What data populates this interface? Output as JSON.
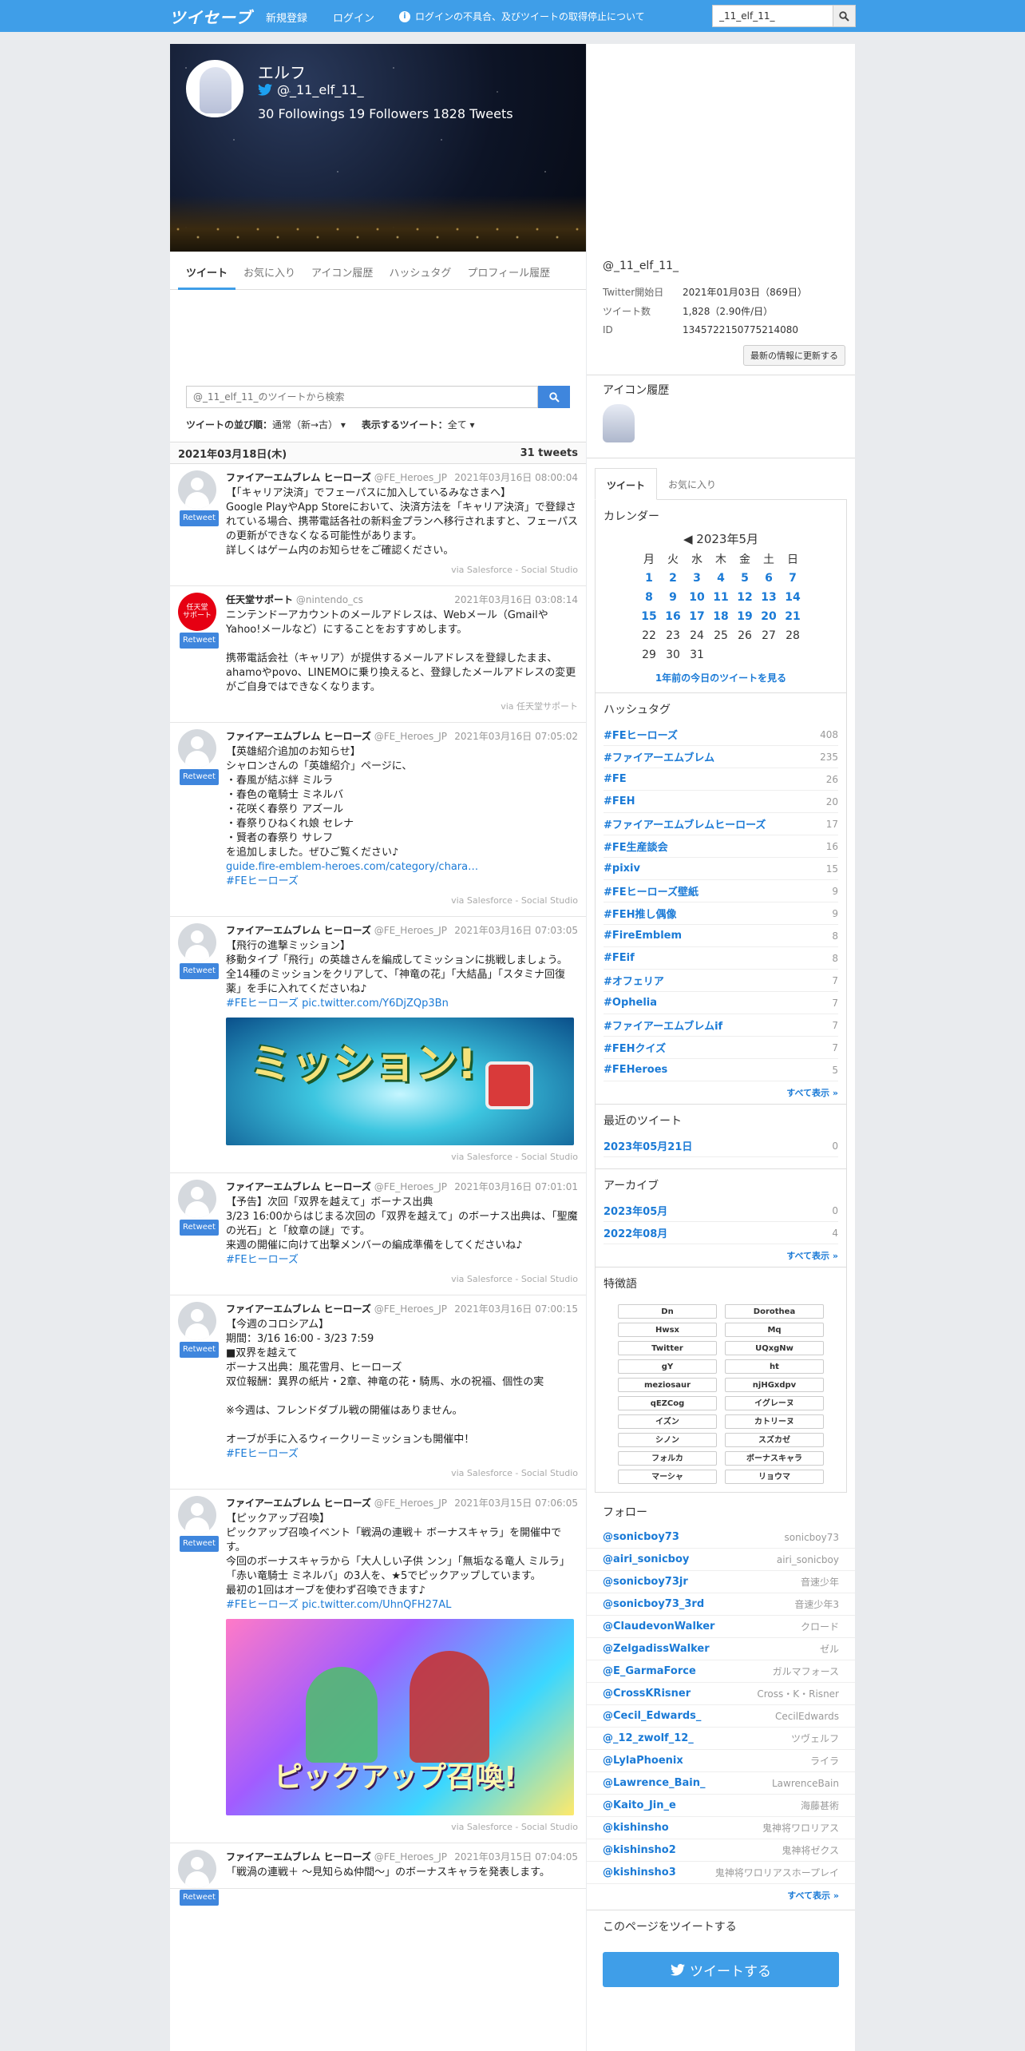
{
  "nav": {
    "logo": "ツイセーブ",
    "signup": "新規登録",
    "login": "ログイン",
    "notice": "ログインの不具合、及びツイートの取得停止について",
    "search_value": "_11_elf_11_"
  },
  "profile": {
    "name": "エルフ",
    "handle": "@_11_elf_11_",
    "stats": "30 Followings  19 Followers  1828 Tweets"
  },
  "tabs": [
    "ツイート",
    "お気に入り",
    "アイコン履歴",
    "ハッシュタグ",
    "プロフィール履歴"
  ],
  "search": {
    "placeholder": "@_11_elf_11_のツイートから検索"
  },
  "sort": {
    "order_label": "ツイートの並び順：",
    "order_value": "通常（新→古）",
    "show_label": "表示するツイート：",
    "show_value": "全て"
  },
  "date_header": {
    "date": "2021年03月18日(木)",
    "count": "31 tweets"
  },
  "retweet_label": "Retweet",
  "tweets": [
    {
      "name": "ファイアーエムブレム ヒーローズ",
      "handle": "@FE_Heroes_JP",
      "time": "2021年03月16日 08:00:04",
      "text": "【「キャリア決済」でフェーパスに加入しているみなさまへ】\nGoogle PlayやApp Storeにおいて、決済方法を「キャリア決済」で登録されている場合、携帯電話各社の新料金プランへ移行されますと、フェーパスの更新ができなくなる可能性があります。\n詳しくはゲーム内のお知らせをご確認ください。",
      "via": "via Salesforce - Social Studio"
    },
    {
      "name": "任天堂サポート",
      "handle": "@nintendo_cs",
      "time": "2021年03月16日 03:08:14",
      "text": "ニンテンドーアカウントのメールアドレスは、Webメール（GmailやYahoo!メールなど）にすることをおすすめします。\n\n携帯電話会社（キャリア）が提供するメールアドレスを登録したまま、ahamoやpovo、LINEMOに乗り換えると、登録したメールアドレスの変更がご自身ではできなくなります。",
      "via": "via 任天堂サポート",
      "avatar_text": "任天堂\nサポート"
    },
    {
      "name": "ファイアーエムブレム ヒーローズ",
      "handle": "@FE_Heroes_JP",
      "time": "2021年03月16日 07:05:02",
      "text": "【英雄紹介追加のお知らせ】\nシャロンさんの「英雄紹介」ページに、\n・春風が結ぶ絆 ミルラ\n・春色の竜騎士 ミネルバ\n・花咲く春祭り アズール\n・春祭りひねくれ娘 セレナ\n・賢者の春祭り サレフ\nを追加しました。ぜひご覧ください♪",
      "link": "guide.fire-emblem-heroes.com/category/chara…",
      "tag": "#FEヒーローズ",
      "via": "via Salesforce - Social Studio"
    },
    {
      "name": "ファイアーエムブレム ヒーローズ",
      "handle": "@FE_Heroes_JP",
      "time": "2021年03月16日 07:03:05",
      "text": "【飛行の進撃ミッション】\n移動タイプ「飛行」の英雄さんを編成してミッションに挑戦しましょう。\n全14種のミッションをクリアして、「神竜の花」「大結晶」「スタミナ回復薬」を手に入れてくださいね♪",
      "tag": "#FEヒーローズ",
      "link": "pic.twitter.com/Y6DjZQp3Bn",
      "img_text": "ミッション!",
      "via": "via Salesforce - Social Studio"
    },
    {
      "name": "ファイアーエムブレム ヒーローズ",
      "handle": "@FE_Heroes_JP",
      "time": "2021年03月16日 07:01:01",
      "text": "【予告】次回「双界を越えて」ボーナス出典\n3/23 16:00からはじまる次回の「双界を越えて」のボーナス出典は、「聖魔の光石」と「紋章の謎」です。\n来週の開催に向けて出撃メンバーの編成準備をしてくださいね♪",
      "tag": "#FEヒーローズ",
      "via": "via Salesforce - Social Studio"
    },
    {
      "name": "ファイアーエムブレム ヒーローズ",
      "handle": "@FE_Heroes_JP",
      "time": "2021年03月16日 07:00:15",
      "text": "【今週のコロシアム】\n期間：3/16 16:00 - 3/23 7:59\n■双界を越えて\nボーナス出典：風花雪月、ヒーローズ\n双位報酬：異界の紙片・2章、神竜の花・騎馬、水の祝福、個性の実\n\n※今週は、フレンドダブル戦の開催はありません。\n\nオーブが手に入るウィークリーミッションも開催中！",
      "tag": "#FEヒーローズ",
      "via": "via Salesforce - Social Studio"
    },
    {
      "name": "ファイアーエムブレム ヒーローズ",
      "handle": "@FE_Heroes_JP",
      "time": "2021年03月15日 07:06:05",
      "text": "【ピックアップ召喚】\nピックアップ召喚イベント「戦渦の連戦＋ ボーナスキャラ」を開催中です。\n今回のボーナスキャラから「大人しい子供 ンン」「無垢なる竜人 ミルラ」「赤い竜騎士 ミネルバ」の3人を、★5でピックアップしています。\n最初の1回はオーブを使わず召喚できます♪",
      "tag": "#FEヒーローズ",
      "link": "pic.twitter.com/UhnQFH27AL",
      "img_text": "ピックアップ召喚!",
      "via": "via Salesforce - Social Studio"
    },
    {
      "name": "ファイアーエムブレム ヒーローズ",
      "handle": "@FE_Heroes_JP",
      "time": "2021年03月15日 07:04:05",
      "text": "「戦渦の連戦＋ ～見知らぬ仲間～」のボーナスキャラを発表します。"
    }
  ],
  "profile_info": {
    "handle": "@_11_elf_11_",
    "rows": [
      {
        "k": "Twitter開始日",
        "v": "2021年01月03日（869日）"
      },
      {
        "k": "ツイート数",
        "v": "1,828（2.90件/日）"
      },
      {
        "k": "ID",
        "v": "1345722150775214080"
      }
    ],
    "update_button": "最新の情報に更新する"
  },
  "icon_history_title": "アイコン履歴",
  "side_tabs": [
    "ツイート",
    "お気に入り"
  ],
  "calendar": {
    "title": "カレンダー",
    "month": "2023年5月",
    "weekdays": [
      "月",
      "火",
      "水",
      "木",
      "金",
      "土",
      "日"
    ],
    "linked_days": [
      1,
      2,
      3,
      4,
      5,
      6,
      7,
      8,
      9,
      10,
      11,
      12,
      13,
      14,
      15,
      16,
      17,
      18,
      19,
      20,
      21
    ],
    "last_day": 31,
    "year_ago_link": "1年前の今日のツイートを見る"
  },
  "hashtags": {
    "title": "ハッシュタグ",
    "items": [
      {
        "tag": "#FEヒーローズ",
        "count": "408"
      },
      {
        "tag": "#ファイアーエムブレム",
        "count": "235"
      },
      {
        "tag": "#FE",
        "count": "26"
      },
      {
        "tag": "#FEH",
        "count": "20"
      },
      {
        "tag": "#ファイアーエムブレムヒーローズ",
        "count": "17"
      },
      {
        "tag": "#FE生産談会",
        "count": "16"
      },
      {
        "tag": "#pixiv",
        "count": "15"
      },
      {
        "tag": "#FEヒーローズ壁紙",
        "count": "9"
      },
      {
        "tag": "#FEH推し偶像",
        "count": "9"
      },
      {
        "tag": "#FireEmblem",
        "count": "8"
      },
      {
        "tag": "#FEif",
        "count": "8"
      },
      {
        "tag": "#オフェリア",
        "count": "7"
      },
      {
        "tag": "#Ophelia",
        "count": "7"
      },
      {
        "tag": "#ファイアーエムブレムif",
        "count": "7"
      },
      {
        "tag": "#FEHクイズ",
        "count": "7"
      },
      {
        "tag": "#FEHeroes",
        "count": "5"
      }
    ],
    "more": "すべて表示 »"
  },
  "recent": {
    "title": "最近のツイート",
    "items": [
      {
        "label": "2023年05月21日",
        "count": "0"
      }
    ]
  },
  "archive": {
    "title": "アーカイブ",
    "items": [
      {
        "label": "2023年05月",
        "count": "0"
      },
      {
        "label": "2022年08月",
        "count": "4"
      }
    ],
    "more": "すべて表示 »"
  },
  "words": {
    "title": "特徴語",
    "items": [
      "Dn",
      "Dorothea",
      "Hwsx",
      "Mq",
      "Twitter",
      "UQxgNw",
      "gY",
      "ht",
      "meziosaur",
      "njHGxdpv",
      "qEZCog",
      "イグレーヌ",
      "イズン",
      "カトリーヌ",
      "シノン",
      "スズカゼ",
      "フォルカ",
      "ボーナスキャラ",
      "マーシャ",
      "リョウマ"
    ]
  },
  "follow": {
    "title": "フォロー",
    "items": [
      {
        "h": "@sonicboy73",
        "n": "sonicboy73"
      },
      {
        "h": "@airi_sonicboy",
        "n": "airi_sonicboy"
      },
      {
        "h": "@sonicboy73jr",
        "n": "音速少年"
      },
      {
        "h": "@sonicboy73_3rd",
        "n": "音速少年3"
      },
      {
        "h": "@ClaudevonWalker",
        "n": "クロード"
      },
      {
        "h": "@ZelgadissWalker",
        "n": "ゼル"
      },
      {
        "h": "@E_GarmaForce",
        "n": "ガルマフォース"
      },
      {
        "h": "@CrossKRisner",
        "n": "Cross・K・Risner"
      },
      {
        "h": "@Cecil_Edwards_",
        "n": "CecilEdwards"
      },
      {
        "h": "@_12_zwolf_12_",
        "n": "ツヴェルフ"
      },
      {
        "h": "@LylaPhoenix",
        "n": "ライラ"
      },
      {
        "h": "@Lawrence_Bain_",
        "n": "LawrenceBain"
      },
      {
        "h": "@Kaito_Jin_e",
        "n": "海藤甚術"
      },
      {
        "h": "@kishinsho",
        "n": "鬼神将ワロリアス"
      },
      {
        "h": "@kishinsho2",
        "n": "鬼神将ゼクス"
      },
      {
        "h": "@kishinsho3",
        "n": "鬼神将ワロリアスホープレイ"
      }
    ],
    "more": "すべて表示 »"
  },
  "share": {
    "title": "このページをツイートする",
    "button": "ツイートする"
  }
}
